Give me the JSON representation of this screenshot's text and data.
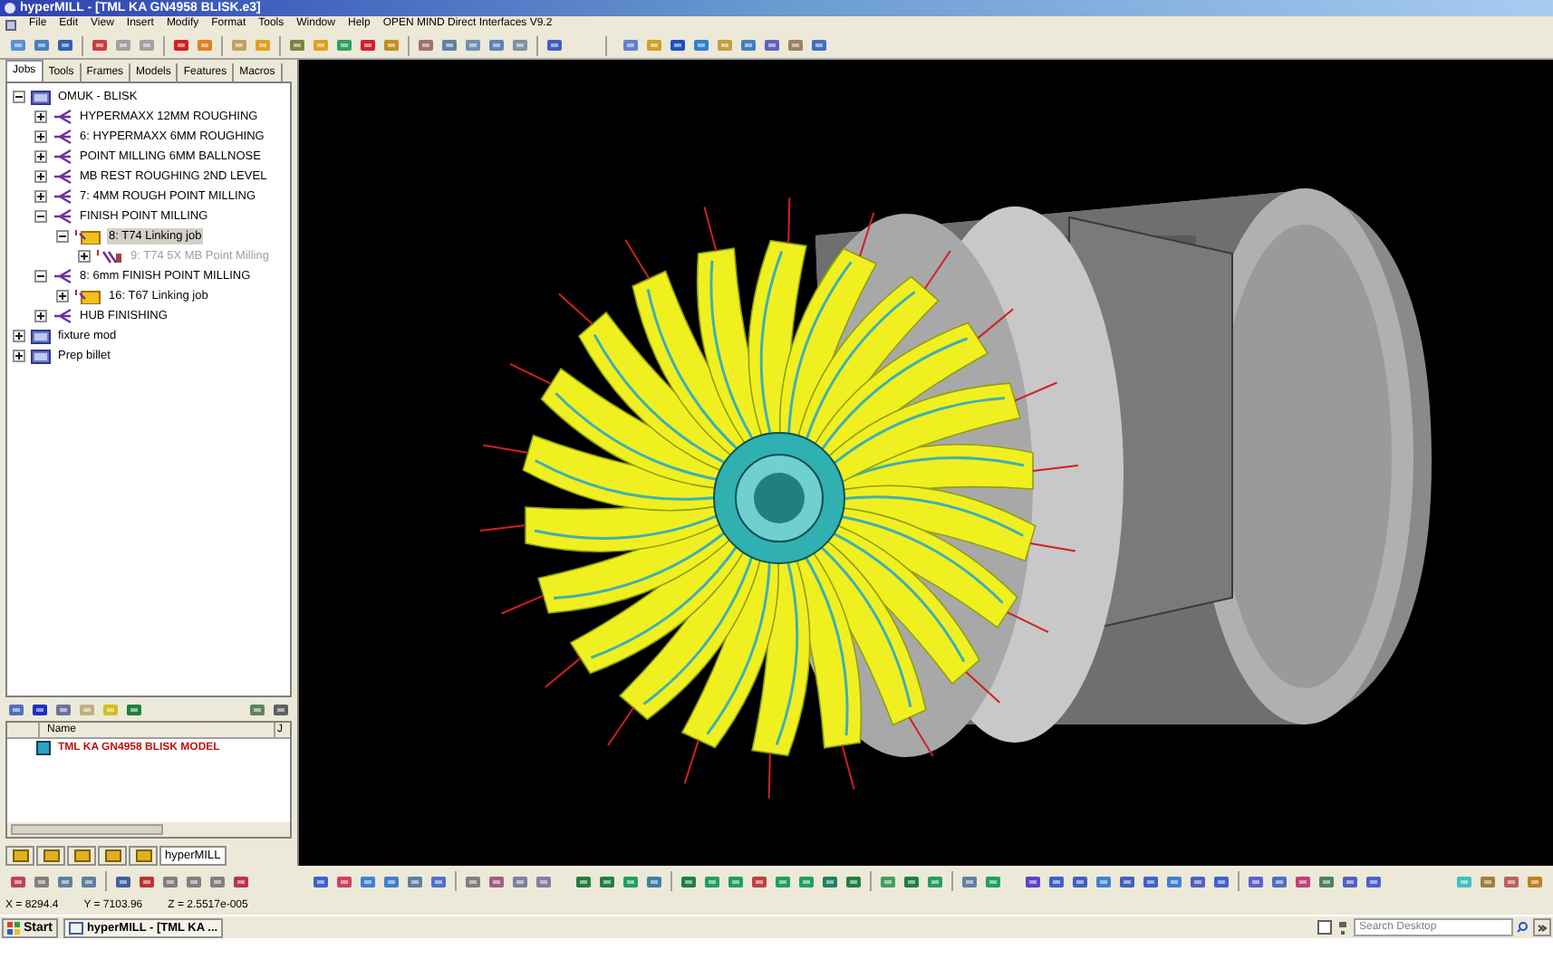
{
  "window": {
    "title": "hyperMILL - [TML KA GN4958 BLISK.e3]"
  },
  "menu": [
    "File",
    "Edit",
    "View",
    "Insert",
    "Modify",
    "Format",
    "Tools",
    "Window",
    "Help",
    "OPEN MIND Direct Interfaces V9.2"
  ],
  "browser_tabs": [
    {
      "label": "Jobs",
      "selected": true
    },
    {
      "label": "Tools",
      "selected": false
    },
    {
      "label": "Frames",
      "selected": false
    },
    {
      "label": "Models",
      "selected": false
    },
    {
      "label": "Features",
      "selected": false
    },
    {
      "label": "Macros",
      "selected": false
    }
  ],
  "job_tree": [
    {
      "label": "OMUK - BLISK",
      "kind": "root",
      "expanded": true,
      "selected": false,
      "children": [
        {
          "label": "HYPERMAXX 12MM ROUGHING",
          "kind": "list",
          "expanded": false,
          "selected": false
        },
        {
          "label": "6: HYPERMAXX 6MM ROUGHING",
          "kind": "list",
          "expanded": false,
          "selected": false
        },
        {
          "label": "POINT MILLING 6MM BALLNOSE",
          "kind": "list",
          "expanded": false,
          "selected": false
        },
        {
          "label": "MB REST ROUGHING 2ND LEVEL",
          "kind": "list",
          "expanded": false,
          "selected": false
        },
        {
          "label": "7: 4MM ROUGH POINT MILLING",
          "kind": "list",
          "expanded": false,
          "selected": false
        },
        {
          "label": "FINISH POINT MILLING",
          "kind": "list",
          "expanded": true,
          "selected": false,
          "children": [
            {
              "label": "8: T74 Linking job",
              "kind": "linking",
              "expanded": true,
              "selected": true,
              "children": [
                {
                  "label": "9: T74 5X MB Point Milling",
                  "kind": "operation",
                  "expanded": false,
                  "selected": false,
                  "disabled": true
                }
              ]
            }
          ]
        },
        {
          "label": "8: 6mm FINISH POINT MILLING",
          "kind": "list",
          "expanded": true,
          "selected": false,
          "children": [
            {
              "label": "16: T67 Linking job",
              "kind": "linking",
              "expanded": false,
              "selected": false
            }
          ]
        },
        {
          "label": "HUB FINISHING",
          "kind": "list",
          "expanded": false,
          "selected": false
        }
      ]
    },
    {
      "label": "fixture mod",
      "kind": "root",
      "expanded": false,
      "selected": false
    },
    {
      "label": "Prep billet",
      "kind": "root",
      "expanded": false,
      "selected": false
    }
  ],
  "model_list": {
    "columns": [
      "Name",
      "J"
    ],
    "rows": [
      {
        "name": "TML KA GN4958 BLISK MODEL"
      }
    ]
  },
  "panel_tabs": [
    {
      "kind": "icon",
      "selected": false
    },
    {
      "kind": "icon",
      "selected": false
    },
    {
      "kind": "icon",
      "selected": false
    },
    {
      "kind": "icon",
      "selected": false
    },
    {
      "kind": "icon",
      "selected": false
    },
    {
      "kind": "text",
      "label": "hyperMILL",
      "selected": true
    }
  ],
  "status_bar": {
    "x": "X = 8294.4",
    "y": "Y = 7103.96",
    "z": "Z = 2.5517e-005"
  },
  "taskbar": {
    "start": "Start",
    "task": "hyperMILL - [TML KA ...",
    "search_placeholder": "Search Desktop"
  }
}
